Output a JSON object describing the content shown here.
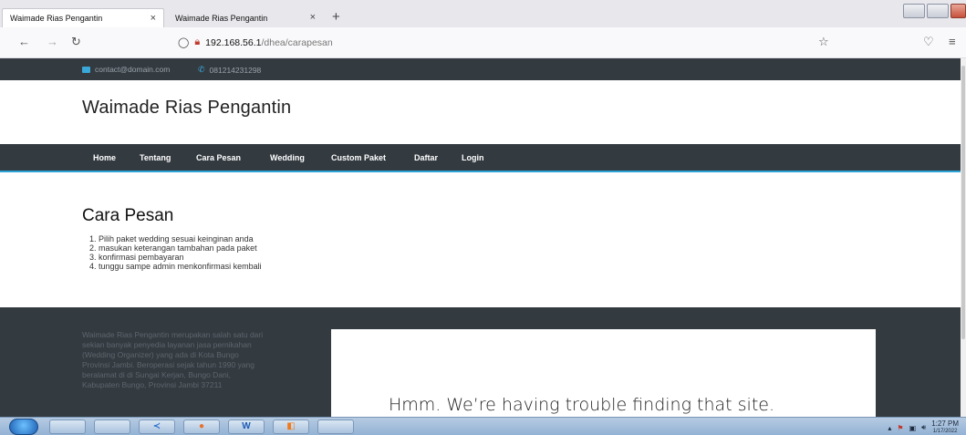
{
  "browser": {
    "tabs": [
      {
        "title": "Waimade Rias Pengantin",
        "active": true
      },
      {
        "title": "Waimade Rias Pengantin",
        "active": false
      }
    ],
    "url_host": "192.168.56.1",
    "url_path": "/dhea/carapesan"
  },
  "topbar": {
    "email": "contact@domain.com",
    "phone": "081214231298"
  },
  "site": {
    "brand": "Waimade Rias Pengantin",
    "menu": [
      "Home",
      "Tentang",
      "Cara Pesan",
      "Wedding",
      "Custom Paket",
      "Daftar",
      "Login"
    ]
  },
  "content": {
    "title": "Cara Pesan",
    "steps": [
      "Pilih paket wedding sesuai keinginan anda",
      "masukan keterangan tambahan pada paket",
      "konfirmasi pembayaran",
      "tunggu sampe admin menkonfirmasi kembali"
    ]
  },
  "footer": {
    "about": "Waimade Rias Pengantin merupakan salah satu dari sekian banyak penyedia layanan jasa pernikahan (Wedding Organizer) yang ada di Kota Bungo Provinsi Jambi. Beroperasi sejak tahun 1990 yang beralamat di di Sungai Kerjan, Bungo Dani, Kabupaten Bungo, Provinsi Jambi 37211",
    "map_error": "Hmm. We’re having trouble finding that site."
  },
  "taskbar": {
    "time": "1:27 PM",
    "date": "1/17/2022"
  },
  "colors": {
    "dark": "#333a40",
    "accent": "#2ea3d6"
  }
}
